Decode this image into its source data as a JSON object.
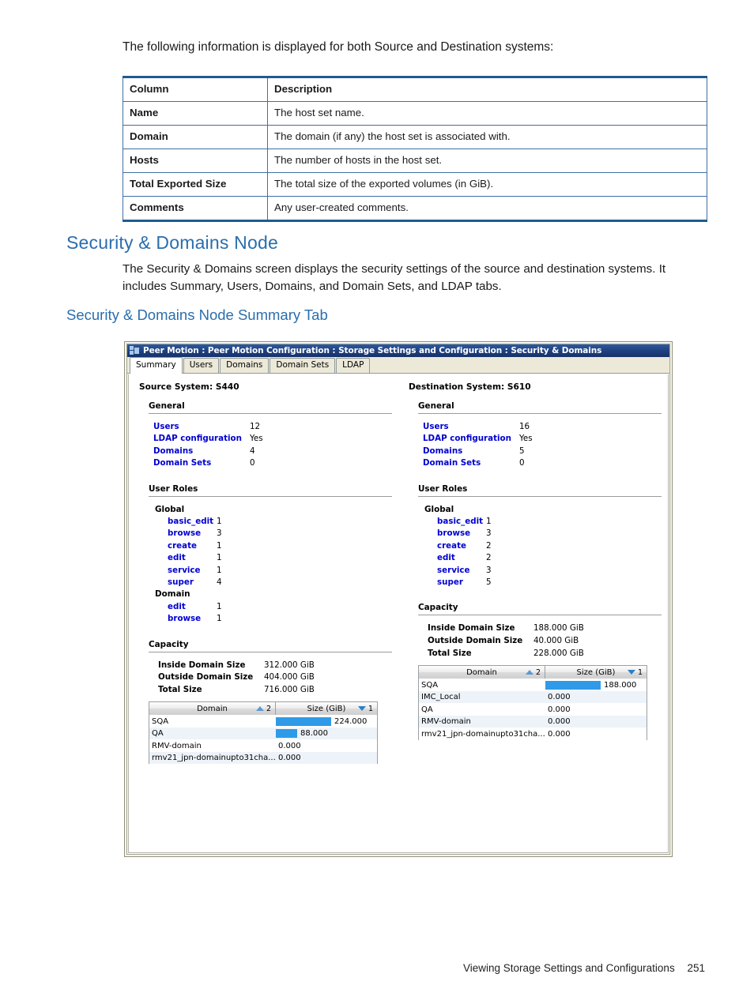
{
  "document": {
    "intro_paragraph": "The following information is displayed for both Source and Destination systems:",
    "table": {
      "headers": [
        "Column",
        "Description"
      ],
      "rows": [
        [
          "Name",
          "The host set name."
        ],
        [
          "Domain",
          "The domain (if any) the host set is associated with."
        ],
        [
          "Hosts",
          "The number of hosts in the host set."
        ],
        [
          "Total Exported Size",
          "The total size of the exported volumes (in GiB)."
        ],
        [
          "Comments",
          "Any user-created comments."
        ]
      ]
    },
    "heading1": "Security & Domains Node",
    "body_paragraph": "The Security & Domains screen displays the security settings of the source and destination systems. It includes Summary, Users, Domains, and Domain Sets, and LDAP tabs.",
    "heading2": "Security & Domains Node Summary Tab",
    "footer": {
      "text": "Viewing Storage Settings and Configurations",
      "page_number": "251"
    },
    "colors": {
      "heading": "#2a6ead",
      "table_border": "#3f6fa5",
      "table_rule": "#1d5c91"
    }
  },
  "app_window": {
    "title": "Peer Motion : Peer Motion Configuration : Storage Settings and Configuration : Security & Domains",
    "tabs": [
      {
        "label": "Summary",
        "active": true
      },
      {
        "label": "Users",
        "active": false
      },
      {
        "label": "Domains",
        "active": false
      },
      {
        "label": "Domain Sets",
        "active": false
      },
      {
        "label": "LDAP",
        "active": false
      }
    ],
    "colors": {
      "titlebar": "#1e3f7d",
      "link": "#0000d0",
      "bar": "#2f9ae8",
      "row_alt": "#edf3f9"
    },
    "source": {
      "system_title": "Source System: S440",
      "general": {
        "heading": "General",
        "items": [
          {
            "label": "Users",
            "value": "12"
          },
          {
            "label": "LDAP configuration",
            "value": "Yes"
          },
          {
            "label": "Domains",
            "value": "4"
          },
          {
            "label": "Domain Sets",
            "value": "0"
          }
        ]
      },
      "user_roles": {
        "heading": "User Roles",
        "groups": [
          {
            "name": "Global",
            "roles": [
              {
                "label": "basic_edit",
                "value": "1"
              },
              {
                "label": "browse",
                "value": "3"
              },
              {
                "label": "create",
                "value": "1"
              },
              {
                "label": "edit",
                "value": "1"
              },
              {
                "label": "service",
                "value": "1"
              },
              {
                "label": "super",
                "value": "4"
              }
            ]
          },
          {
            "name": "Domain",
            "roles": [
              {
                "label": "edit",
                "value": "1"
              },
              {
                "label": "browse",
                "value": "1"
              }
            ]
          }
        ]
      },
      "capacity": {
        "heading": "Capacity",
        "summary": [
          {
            "label": "Inside Domain Size",
            "value": "312.000 GiB"
          },
          {
            "label": "Outside Domain Size",
            "value": "404.000 GiB"
          },
          {
            "label": "Total Size",
            "value": "716.000 GiB"
          }
        ],
        "grid": {
          "columns": [
            {
              "label": "Domain",
              "sort": "asc",
              "sort_order": "2"
            },
            {
              "label": "Size (GiB)",
              "sort": "desc",
              "sort_order": "1"
            }
          ],
          "rows": [
            {
              "domain": "SQA",
              "size": "224.000",
              "bar_pct": 100
            },
            {
              "domain": "QA",
              "size": "88.000",
              "bar_pct": 39
            },
            {
              "domain": "RMV-domain",
              "size": "0.000",
              "bar_pct": 0
            },
            {
              "domain": "rmv21_jpn-domainupto31cha...",
              "size": "0.000",
              "bar_pct": 0
            }
          ]
        }
      }
    },
    "destination": {
      "system_title": "Destination System: S610",
      "general": {
        "heading": "General",
        "items": [
          {
            "label": "Users",
            "value": "16"
          },
          {
            "label": "LDAP configuration",
            "value": "Yes"
          },
          {
            "label": "Domains",
            "value": "5"
          },
          {
            "label": "Domain Sets",
            "value": "0"
          }
        ]
      },
      "user_roles": {
        "heading": "User Roles",
        "groups": [
          {
            "name": "Global",
            "roles": [
              {
                "label": "basic_edit",
                "value": "1"
              },
              {
                "label": "browse",
                "value": "3"
              },
              {
                "label": "create",
                "value": "2"
              },
              {
                "label": "edit",
                "value": "2"
              },
              {
                "label": "service",
                "value": "3"
              },
              {
                "label": "super",
                "value": "5"
              }
            ]
          }
        ]
      },
      "capacity": {
        "heading": "Capacity",
        "summary": [
          {
            "label": "Inside Domain Size",
            "value": "188.000 GiB"
          },
          {
            "label": "Outside Domain Size",
            "value": "40.000 GiB"
          },
          {
            "label": "Total Size",
            "value": "228.000 GiB"
          }
        ],
        "grid": {
          "columns": [
            {
              "label": "Domain",
              "sort": "asc",
              "sort_order": "2"
            },
            {
              "label": "Size (GiB)",
              "sort": "desc",
              "sort_order": "1"
            }
          ],
          "rows": [
            {
              "domain": "SQA",
              "size": "188.000",
              "bar_pct": 100
            },
            {
              "domain": "IMC_Local",
              "size": "0.000",
              "bar_pct": 0
            },
            {
              "domain": "QA",
              "size": "0.000",
              "bar_pct": 0
            },
            {
              "domain": "RMV-domain",
              "size": "0.000",
              "bar_pct": 0
            },
            {
              "domain": "rmv21_jpn-domainupto31cha...",
              "size": "0.000",
              "bar_pct": 0
            }
          ]
        }
      }
    }
  }
}
